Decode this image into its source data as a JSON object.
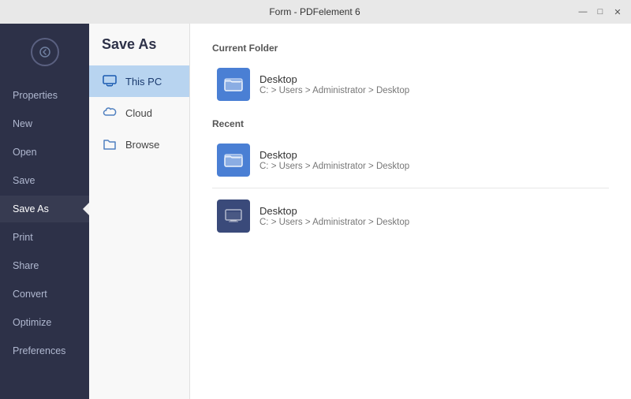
{
  "titleBar": {
    "title": "Form - PDFelement 6",
    "minimize": "—",
    "restore": "□",
    "close": "✕"
  },
  "sidebar": {
    "items": [
      {
        "id": "properties",
        "label": "Properties"
      },
      {
        "id": "new",
        "label": "New"
      },
      {
        "id": "open",
        "label": "Open"
      },
      {
        "id": "save",
        "label": "Save"
      },
      {
        "id": "save-as",
        "label": "Save As",
        "active": true
      },
      {
        "id": "print",
        "label": "Print"
      },
      {
        "id": "share",
        "label": "Share"
      },
      {
        "id": "convert",
        "label": "Convert"
      },
      {
        "id": "optimize",
        "label": "Optimize"
      },
      {
        "id": "preferences",
        "label": "Preferences"
      }
    ]
  },
  "midPanel": {
    "title": "Save As",
    "items": [
      {
        "id": "this-pc",
        "label": "This PC",
        "active": true,
        "icon": "monitor"
      },
      {
        "id": "cloud",
        "label": "Cloud",
        "icon": "cloud"
      },
      {
        "id": "browse",
        "label": "Browse",
        "icon": "folder"
      }
    ]
  },
  "content": {
    "currentFolder": {
      "sectionLabel": "Current Folder",
      "items": [
        {
          "name": "Desktop",
          "path": "C: > Users > Administrator > Desktop",
          "iconType": "light"
        }
      ]
    },
    "recent": {
      "sectionLabel": "Recent",
      "items": [
        {
          "name": "Desktop",
          "path": "C: > Users > Administrator > Desktop",
          "iconType": "light"
        },
        {
          "name": "Desktop",
          "path": "C: > Users > Administrator > Desktop",
          "iconType": "dark"
        }
      ]
    }
  }
}
